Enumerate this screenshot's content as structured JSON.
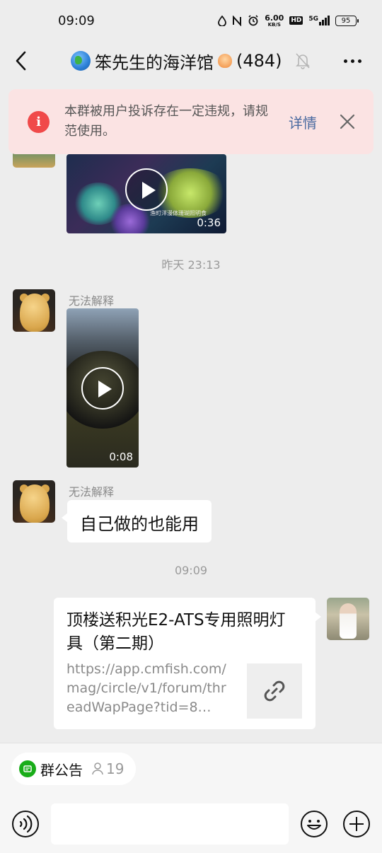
{
  "status_bar": {
    "time": "09:09",
    "net_speed_value": "6.00",
    "net_speed_unit": "KB/S",
    "hd_label": "HD",
    "network_type": "5G",
    "battery_level": "95"
  },
  "header": {
    "title": "笨先生的海洋馆",
    "member_count": "(484)",
    "icons": [
      "back-icon",
      "globe-icon",
      "shell-icon",
      "bell-muted-icon",
      "more-icon"
    ]
  },
  "warning": {
    "text": "本群被用户投诉存在一定违规，请规范使用。",
    "detail_label": "详情",
    "icon": "info-icon",
    "color": "#f04a4a"
  },
  "messages": {
    "video_top": {
      "duration": "0:36",
      "watermark": "渔町洋漫体珊瑚照明食"
    },
    "timestamp_1": "昨天 23:13",
    "msg_video": {
      "sender": "无法解释",
      "duration": "0:08"
    },
    "msg_text": {
      "sender": "无法解释",
      "text": "自己做的也能用"
    },
    "timestamp_2": "09:09",
    "link_card": {
      "title": "顶楼送积光E2-ATS专用照明灯具（第二期）",
      "url": "https://app.cmfish.com/mag/circle/v1/forum/threadWapPage?tid=8…",
      "icon": "link-icon"
    }
  },
  "bottom": {
    "notice_label": "群公告",
    "notice_count": "19",
    "input_placeholder": "",
    "icons": [
      "voice-icon",
      "emoji-icon",
      "plus-icon"
    ]
  },
  "colors": {
    "background": "#ededed",
    "warning_bg": "#fbe3e3",
    "link_blue": "#4a6aa0",
    "notice_green": "#1aad19"
  }
}
